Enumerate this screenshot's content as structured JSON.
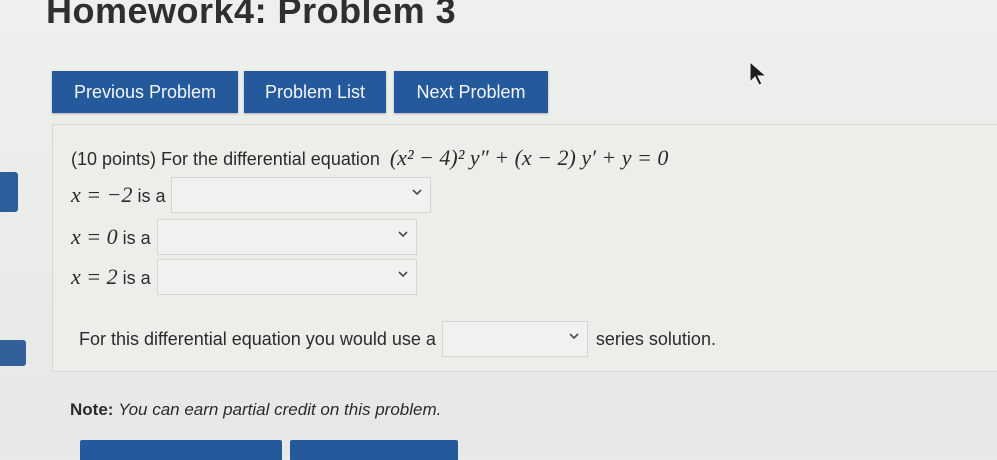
{
  "page": {
    "title": "Homework4: Problem 3"
  },
  "nav": {
    "previous_label": "Previous Problem",
    "list_label": "Problem List",
    "next_label": "Next Problem"
  },
  "problem": {
    "points_prefix": "(10 points) For the differential equation",
    "equation": "(x² − 4)² y″ + (x − 2) y′ + y = 0",
    "rows": [
      {
        "point": "x = −2",
        "suffix": "is a",
        "selected": ""
      },
      {
        "point": "x = 0",
        "suffix": "is a",
        "selected": ""
      },
      {
        "point": "x = 2",
        "suffix": "is a",
        "selected": ""
      }
    ],
    "series_prefix": "For this differential equation you would use a",
    "series_selected": "",
    "series_suffix": "series solution."
  },
  "note": {
    "label": "Note:",
    "text": "You can earn partial credit on this problem."
  },
  "icons": {
    "cursor": "mouse-pointer-icon",
    "dropdown": "chevron-down-icon"
  },
  "colors": {
    "button_blue": "#245a9b",
    "background": "#e9ebe8"
  }
}
